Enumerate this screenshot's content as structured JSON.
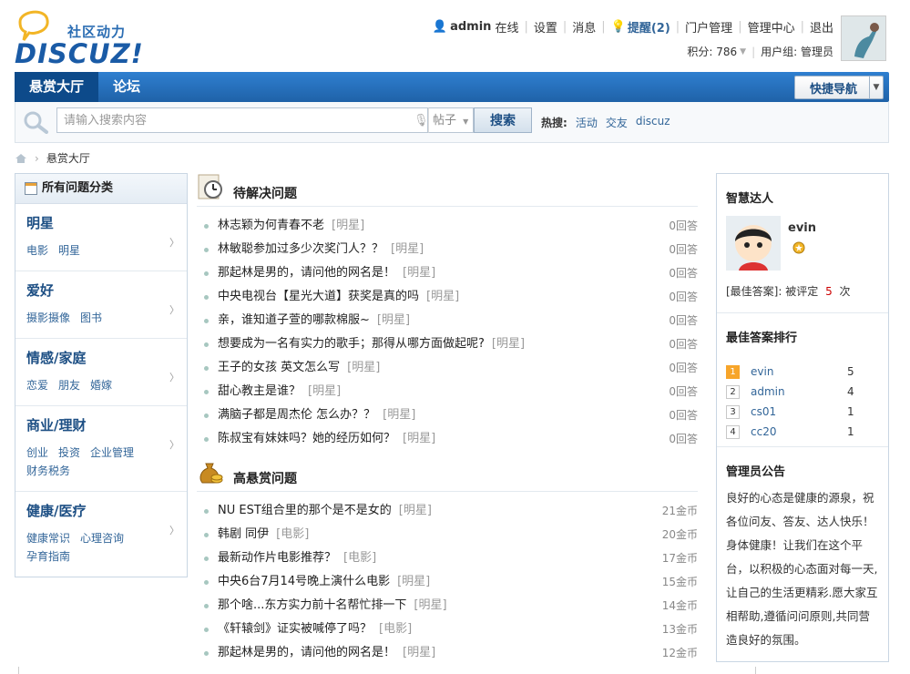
{
  "site": {
    "slogan": "社区动力",
    "logo_text": "DISCUZ!"
  },
  "user_bar": {
    "username": "admin",
    "status": "在线",
    "links": [
      "设置",
      "消息"
    ],
    "remind_label": "提醒(2)",
    "links2": [
      "门户管理",
      "管理中心",
      "退出"
    ],
    "points_label": "积分: 786",
    "group_label": "用户组: 管理员"
  },
  "nav": {
    "items": [
      "悬赏大厅",
      "论坛"
    ],
    "quick_nav": "快捷导航"
  },
  "search": {
    "placeholder": "请输入搜索内容",
    "scope": "帖子",
    "button": "搜索",
    "hot_label": "热搜:",
    "hot_terms": [
      "活动",
      "交友",
      "discuz"
    ]
  },
  "breadcrumb": {
    "current": "悬赏大厅"
  },
  "categories": {
    "header": "所有问题分类",
    "items": [
      {
        "title": "明星",
        "subs": [
          "电影",
          "明星"
        ]
      },
      {
        "title": "爱好",
        "subs": [
          "摄影摄像",
          "图书"
        ]
      },
      {
        "title": "情感/家庭",
        "subs": [
          "恋爱",
          "朋友",
          "婚嫁"
        ]
      },
      {
        "title": "商业/理财",
        "subs": [
          "创业",
          "投资",
          "企业管理",
          "财务税务"
        ]
      },
      {
        "title": "健康/医疗",
        "subs": [
          "健康常识",
          "心理咨询",
          "孕育指南"
        ]
      }
    ]
  },
  "pending": {
    "title": "待解决问题",
    "items": [
      {
        "q": "林志颖为何青春不老",
        "tag": "[明星]",
        "stat": "0回答"
      },
      {
        "q": "林敏聪参加过多少次奖门人？？",
        "tag": "[明星]",
        "stat": "0回答"
      },
      {
        "q": "那起林是男的，请问他的网名是！",
        "tag": "[明星]",
        "stat": "0回答"
      },
      {
        "q": "中央电视台【星光大道】获奖是真的吗",
        "tag": "[明星]",
        "stat": "0回答"
      },
      {
        "q": "亲，谁知道子萱的哪款棉服~",
        "tag": "[明星]",
        "stat": "0回答"
      },
      {
        "q": "想要成为一名有实力的歌手；那得从哪方面做起呢?",
        "tag": "[明星]",
        "stat": "0回答"
      },
      {
        "q": "王子的女孩 英文怎么写",
        "tag": "[明星]",
        "stat": "0回答"
      },
      {
        "q": "甜心教主是谁？",
        "tag": "[明星]",
        "stat": "0回答"
      },
      {
        "q": "满脑子都是周杰伦 怎么办？？",
        "tag": "[明星]",
        "stat": "0回答"
      },
      {
        "q": "陈叔宝有妹妹吗？她的经历如何？",
        "tag": "[明星]",
        "stat": "0回答"
      }
    ]
  },
  "reward": {
    "title": "高悬赏问题",
    "items": [
      {
        "q": "NU EST组合里的那个是不是女的",
        "tag": "[明星]",
        "stat": "21金币"
      },
      {
        "q": "韩剧 同伊",
        "tag": "[电影]",
        "stat": "20金币"
      },
      {
        "q": "最新动作片电影推荐？",
        "tag": "[电影]",
        "stat": "17金币"
      },
      {
        "q": "中央6台7月14号晚上演什么电影",
        "tag": "[明星]",
        "stat": "15金币"
      },
      {
        "q": "那个啥...东方实力前十名帮忙排一下",
        "tag": "[明星]",
        "stat": "14金币"
      },
      {
        "q": "《轩辕剑》证实被喊停了吗？",
        "tag": "[电影]",
        "stat": "13金币"
      },
      {
        "q": "那起林是男的，请问他的网名是！",
        "tag": "[明星]",
        "stat": "12金币"
      }
    ]
  },
  "expert": {
    "title": "智慧达人",
    "name": "evin",
    "best_prefix": "[最佳答案]: 被评定",
    "best_count": "5",
    "best_suffix": "次"
  },
  "ranking": {
    "title": "最佳答案排行",
    "items": [
      {
        "rank": "1",
        "user": "evin",
        "count": "5"
      },
      {
        "rank": "2",
        "user": "admin",
        "count": "4"
      },
      {
        "rank": "3",
        "user": "cs01",
        "count": "1"
      },
      {
        "rank": "4",
        "user": "cc20",
        "count": "1"
      }
    ]
  },
  "announcement": {
    "title": "管理员公告",
    "text": "良好的心态是健康的源泉，祝各位问友、答友、达人快乐！身体健康！让我们在这个平台，以积极的心态面对每一天,让自己的生活更精彩.愿大家互相帮助,遵循问问原则,共同营造良好的氛围。"
  },
  "colors": {
    "nav_blue": "#1f62a8",
    "link": "#336699",
    "highlight_red": "#cc0000",
    "rank_first": "#f7a52a"
  }
}
